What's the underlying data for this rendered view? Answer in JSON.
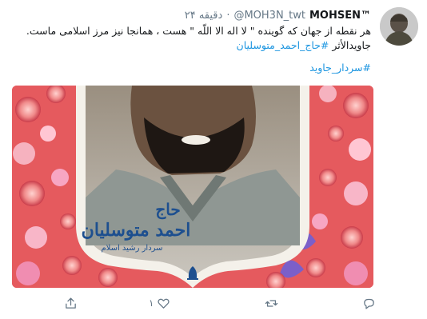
{
  "tweet": {
    "display_name": "MOHSEN™",
    "handle": "@MOH3N_twt",
    "separator": "·",
    "time": "۲۴ دقیقه",
    "lines": [
      "هر نقطه از جهان که گوینده \" لا اله الا اللّه \" هست ، همانجا نیز مرز اسلامی ماست.",
      "جاویدالأثر"
    ],
    "hashtag_1": "#حاج_احمد_متوسلیان",
    "hashtag_2": "#سردار_جاوید"
  },
  "media": {
    "calligraphy_title": "حاج",
    "calligraphy_name": "احمد متوسلیان",
    "subtitle": "سردار رشید اسلام"
  },
  "actions": {
    "reply_count": "",
    "retweet_count": "",
    "like_count": "۱",
    "share_count": ""
  },
  "colors": {
    "link": "#1b95e0",
    "text": "#14171a",
    "muted": "#657786",
    "floral_bg": "#e65a5a"
  }
}
